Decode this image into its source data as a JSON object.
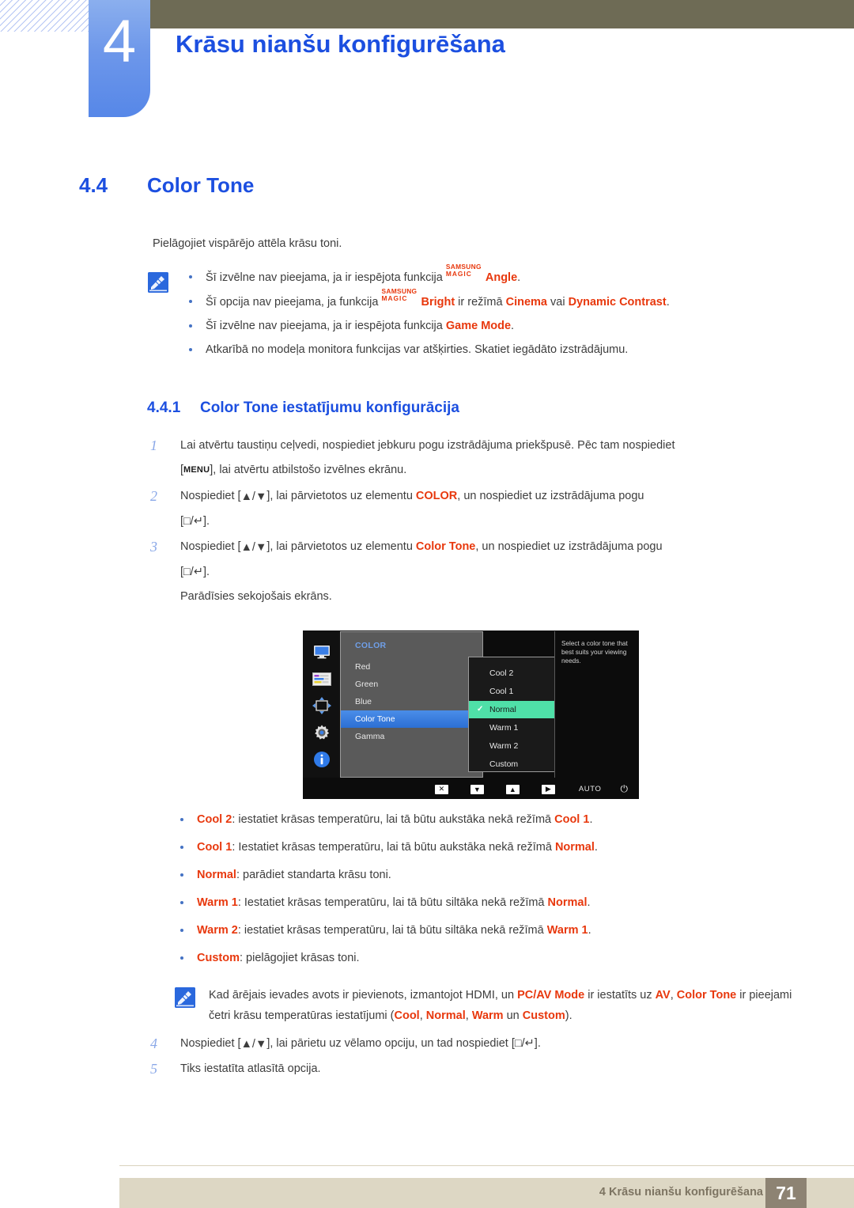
{
  "header": {
    "chapter_number": "4",
    "chapter_title": "Krāsu nianšu konfigurēšana"
  },
  "section": {
    "number": "4.4",
    "title": "Color Tone",
    "intro": "Pielāgojiet vispārējo attēla krāsu toni."
  },
  "notes": {
    "icon": "note-pen-icon",
    "items": [
      {
        "pre": "Šī izvēlne nav pieejama, ja ir iespējota funkcija ",
        "magic_top": "SAMSUNG",
        "magic_bottom": "MAGIC",
        "red1": "Angle",
        "post": "."
      },
      {
        "pre": "Šī opcija nav pieejama, ja funkcija ",
        "magic_top": "SAMSUNG",
        "magic_bottom": "MAGIC",
        "red1": "Bright",
        "mid1": " ir režīmā ",
        "red2": "Cinema",
        "mid2": " vai ",
        "red3": "Dynamic Contrast",
        "post": "."
      },
      {
        "pre": "Šī izvēlne nav pieejama, ja ir iespējota funkcija ",
        "red1": "Game Mode",
        "post": "."
      },
      {
        "pre": "Atkarībā no modeļa monitora funkcijas var atšķirties. Skatiet iegādāto izstrādājumu."
      }
    ]
  },
  "subsection": {
    "number": "4.4.1",
    "title": "Color Tone iestatījumu konfigurācija"
  },
  "steps": [
    {
      "n": "1",
      "line1_a": "Lai atvērtu taustiņu ceļvedi, nospiediet jebkuru pogu izstrādājuma priekšpusē. Pēc tam nospiediet",
      "line2_pre": "[",
      "line2_key": "MENU",
      "line2_post": "], lai atvērtu atbilstošo izvēlnes ekrānu."
    },
    {
      "n": "2",
      "line1_a": "Nospiediet [",
      "line1_arrows": "▲/▼",
      "line1_b": "], lai pārvietotos uz elementu ",
      "line1_red": "COLOR",
      "line1_c": ", un nospiediet uz izstrādājuma pogu",
      "line2": "[□/↵]."
    },
    {
      "n": "3",
      "line1_a": "Nospiediet [",
      "line1_arrows": "▲/▼",
      "line1_b": "], lai pārvietotos uz elementu ",
      "line1_red": "Color Tone",
      "line1_c": ", un nospiediet uz izstrādājuma pogu",
      "line2": "[□/↵].",
      "line3": "Parādīsies sekojošais ekrāns."
    }
  ],
  "osd": {
    "sidebar_icons": [
      "monitor-icon",
      "picture-sliders-icon",
      "position-arrows-icon",
      "gear-icon",
      "info-icon"
    ],
    "category": "COLOR",
    "menu_items": [
      {
        "label": "Red",
        "selected": false
      },
      {
        "label": "Green",
        "selected": false
      },
      {
        "label": "Blue",
        "selected": false
      },
      {
        "label": "Color Tone",
        "selected": true
      },
      {
        "label": "Gamma",
        "selected": false
      }
    ],
    "submenu_options": [
      {
        "label": "Cool 2",
        "checked": false
      },
      {
        "label": "Cool 1",
        "checked": false
      },
      {
        "label": "Normal",
        "checked": true
      },
      {
        "label": "Warm 1",
        "checked": false
      },
      {
        "label": "Warm 2",
        "checked": false
      },
      {
        "label": "Custom",
        "checked": false
      }
    ],
    "help_text": "Select a color tone that best suits your viewing needs.",
    "bottom_buttons": [
      "✕",
      "▼",
      "▲",
      "▶"
    ],
    "auto_label": "AUTO",
    "power_icon": "power-icon"
  },
  "option_list": [
    {
      "name": "Cool 2",
      "desc_pre": ": iestatiet krāsas temperatūru, lai tā būtu aukstāka nekā režīmā ",
      "ref": "Cool 1",
      "desc_post": "."
    },
    {
      "name": "Cool 1",
      "desc_pre": ": Iestatiet krāsas temperatūru, lai tā būtu aukstāka nekā režīmā ",
      "ref": "Normal",
      "desc_post": "."
    },
    {
      "name": "Normal",
      "desc_pre": ": parādiet standarta krāsu toni.",
      "ref": "",
      "desc_post": ""
    },
    {
      "name": "Warm 1",
      "desc_pre": ": Iestatiet krāsas temperatūru, lai tā būtu siltāka nekā režīmā ",
      "ref": "Normal",
      "desc_post": "."
    },
    {
      "name": "Warm 2",
      "desc_pre": ": iestatiet krāsas temperatūru, lai tā būtu siltāka nekā režīmā ",
      "ref": "Warm 1",
      "desc_post": "."
    },
    {
      "name": "Custom",
      "desc_pre": ": pielāgojiet krāsas toni.",
      "ref": "",
      "desc_post": ""
    }
  ],
  "bottom_note": {
    "icon": "note-pen-icon",
    "a": "Kad ārējais ievades avots ir pievienots, izmantojot HDMI, un ",
    "r1": "PC/AV Mode",
    "b": " ir iestatīts uz ",
    "r2": "AV",
    "c": ", ",
    "r3": "Color Tone",
    "d": " ir pieejami četri krāsu temperatūras iestatījumi (",
    "r4": "Cool",
    "e": ", ",
    "r5": "Normal",
    "f": ", ",
    "r6": "Warm",
    "g": " un ",
    "r7": "Custom",
    "h": ")."
  },
  "steps_tail": [
    {
      "n": "4",
      "a": "Nospiediet [",
      "arrows": "▲/▼",
      "b": "], lai pārietu uz vēlamo opciju, un tad nospiediet [□/↵]."
    },
    {
      "n": "5",
      "a": "Tiks iestatīta atlasītā opcija."
    }
  ],
  "footer": {
    "text": "4 Krāsu nianšu konfigurēšana",
    "page": "71"
  },
  "colors": {
    "accent_blue": "#1c4fe0",
    "badge_blue": "#6d97ea",
    "olive": "#6e6b55",
    "red": "#e8380d",
    "footer_bar": "#ddd7c4",
    "footer_page": "#8d8373"
  }
}
